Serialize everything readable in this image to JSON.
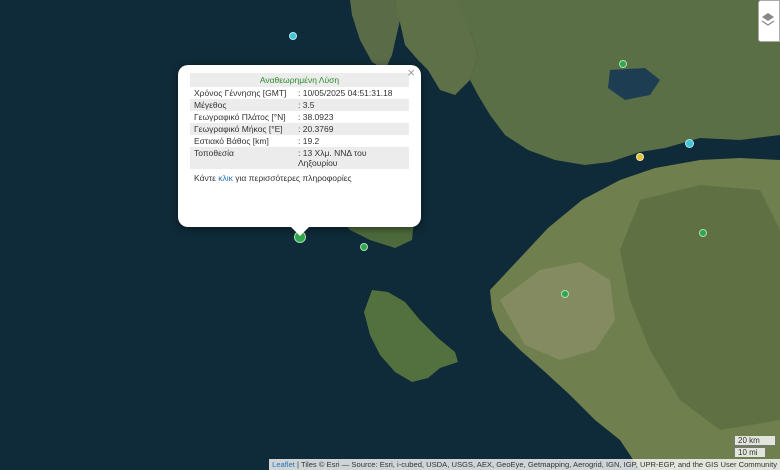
{
  "popup": {
    "title": "Αναθεωρημένη Λύση",
    "close": "×",
    "rows": [
      {
        "label": "Χρόνος Γέννησης [GMT]",
        "value": ": 10/05/2025 04:51:31.18"
      },
      {
        "label": "Μέγεθος",
        "value": ": 3.5"
      },
      {
        "label": "Γεωγραφικό Πλάτος [°N]",
        "value": ": 38.0923"
      },
      {
        "label": "Γεωγραφικό Μήκος [°E]",
        "value": ": 20.3769"
      },
      {
        "label": "Εστιακό Βάθος [km]",
        "value": ": 19.2"
      },
      {
        "label": "Τοποθεσία",
        "value": ": 13 Χλμ. ΝΝΔ του Ληξουρίου"
      }
    ],
    "footer_before": "Κάντε ",
    "footer_link": "κλικ",
    "footer_after": " για περισσότερες πληροφορίες"
  },
  "scale": {
    "metric": "20 km",
    "imperial": "10 mi"
  },
  "attribution": {
    "leaflet": "Leaflet",
    "text": " | Tiles © Esri — Source: Esri, i-cubed, USDA, USGS, AEX, GeoEye, Getmapping, Aerogrid, IGN, IGP, UPR-EGP, and the GIS User Community"
  },
  "colors": {
    "sea": "#0f2a3a",
    "land": "#4f6b3f",
    "marker_green": "#2ea84a",
    "marker_cyan": "#3fc4d8",
    "marker_yellow": "#e3c23a"
  }
}
